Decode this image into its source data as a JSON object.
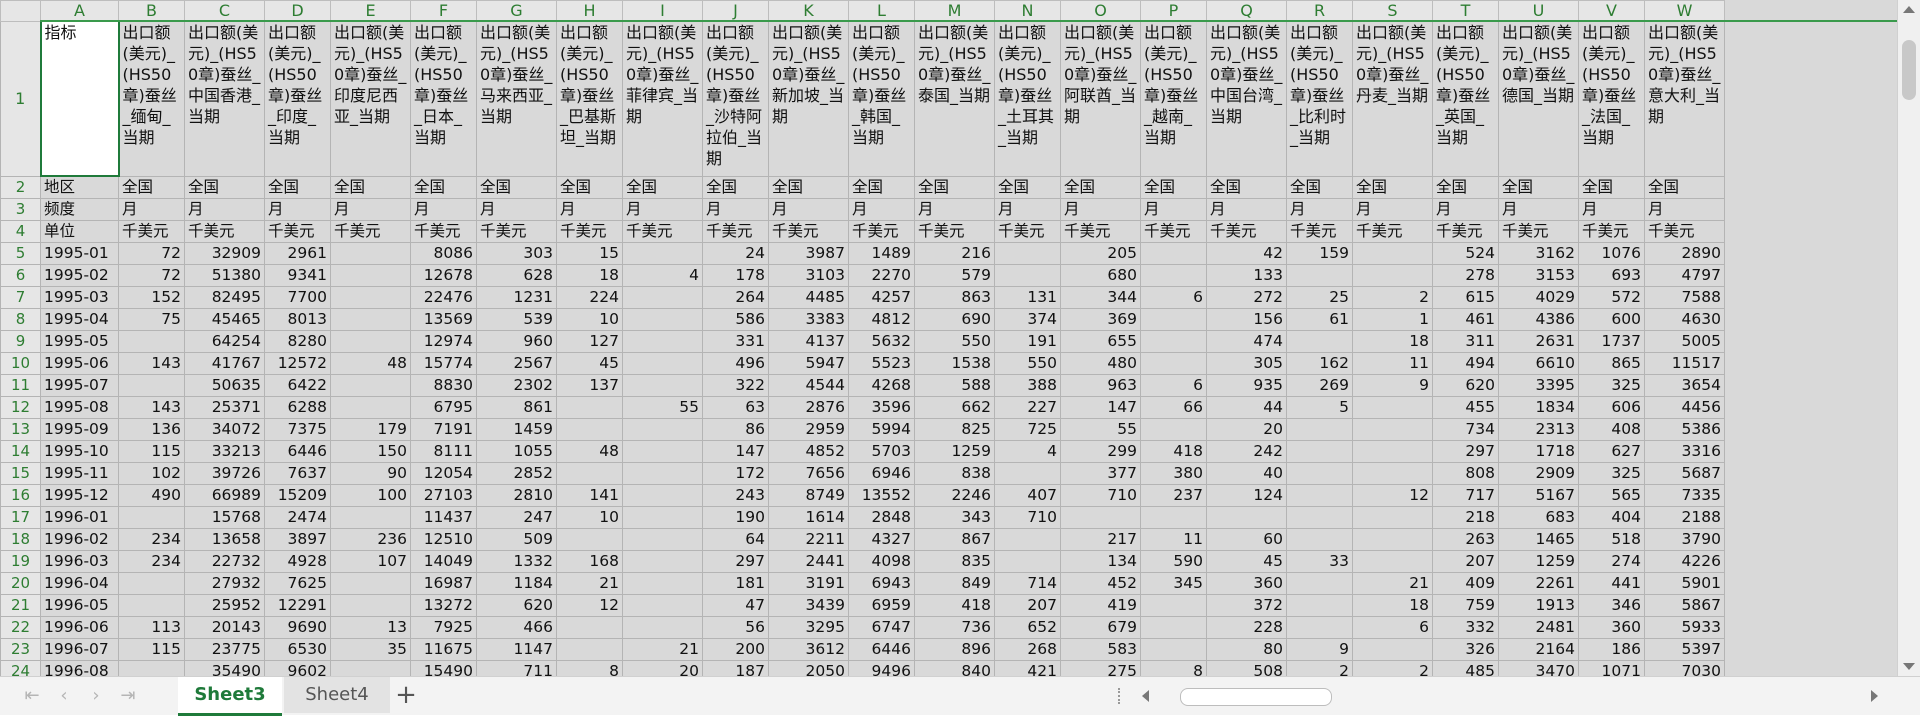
{
  "sheet": {
    "columns": [
      "A",
      "B",
      "C",
      "D",
      "E",
      "F",
      "G",
      "H",
      "I",
      "J",
      "K",
      "L",
      "M",
      "N",
      "O",
      "P",
      "Q",
      "R",
      "S",
      "T",
      "U",
      "V",
      "W"
    ],
    "header_row": [
      "指标",
      "出口额(美元)_(HS50章)蚕丝_缅甸_当期",
      "出口额(美元)_(HS50章)蚕丝_中国香港_当期",
      "出口额(美元)_(HS50章)蚕丝_印度_当期",
      "出口额(美元)_(HS50章)蚕丝_印度尼西亚_当期",
      "出口额(美元)_(HS50章)蚕丝_日本_当期",
      "出口额(美元)_(HS50章)蚕丝_马来西亚_当期",
      "出口额(美元)_(HS50章)蚕丝_巴基斯坦_当期",
      "出口额(美元)_(HS50章)蚕丝_菲律宾_当期",
      "出口额(美元)_(HS50章)蚕丝_沙特阿拉伯_当期",
      "出口额(美元)_(HS50章)蚕丝_新加坡_当期",
      "出口额(美元)_(HS50章)蚕丝_韩国_当期",
      "出口额(美元)_(HS50章)蚕丝_泰国_当期",
      "出口额(美元)_(HS50章)蚕丝_土耳其_当期",
      "出口额(美元)_(HS50章)蚕丝_阿联酋_当期",
      "出口额(美元)_(HS50章)蚕丝_越南_当期",
      "出口额(美元)_(HS50章)蚕丝_中国台湾_当期",
      "出口额(美元)_(HS50章)蚕丝_比利时_当期",
      "出口额(美元)_(HS50章)蚕丝_丹麦_当期",
      "出口额(美元)_(HS50章)蚕丝_英国_当期",
      "出口额(美元)_(HS50章)蚕丝_德国_当期",
      "出口额(美元)_(HS50章)蚕丝_法国_当期",
      "出口额(美元)_(HS50章)蚕丝_意大利_当期"
    ],
    "meta_rows": [
      [
        "地区",
        "全国",
        "全国",
        "全国",
        "全国",
        "全国",
        "全国",
        "全国",
        "全国",
        "全国",
        "全国",
        "全国",
        "全国",
        "全国",
        "全国",
        "全国",
        "全国",
        "全国",
        "全国",
        "全国",
        "全国",
        "全国",
        "全国"
      ],
      [
        "频度",
        "月",
        "月",
        "月",
        "月",
        "月",
        "月",
        "月",
        "月",
        "月",
        "月",
        "月",
        "月",
        "月",
        "月",
        "月",
        "月",
        "月",
        "月",
        "月",
        "月",
        "月",
        "月"
      ],
      [
        "单位",
        "千美元",
        "千美元",
        "千美元",
        "千美元",
        "千美元",
        "千美元",
        "千美元",
        "千美元",
        "千美元",
        "千美元",
        "千美元",
        "千美元",
        "千美元",
        "千美元",
        "千美元",
        "千美元",
        "千美元",
        "千美元",
        "千美元",
        "千美元",
        "千美元",
        "千美元"
      ]
    ],
    "data_rows": [
      [
        "1995-01",
        "72",
        "32909",
        "2961",
        "",
        "8086",
        "303",
        "15",
        "",
        "24",
        "3987",
        "1489",
        "216",
        "",
        "205",
        "",
        "42",
        "159",
        "",
        "524",
        "3162",
        "1076",
        "2890"
      ],
      [
        "1995-02",
        "72",
        "51380",
        "9341",
        "",
        "12678",
        "628",
        "18",
        "4",
        "178",
        "3103",
        "2270",
        "579",
        "",
        "680",
        "",
        "133",
        "",
        "",
        "278",
        "3153",
        "693",
        "4797"
      ],
      [
        "1995-03",
        "152",
        "82495",
        "7700",
        "",
        "22476",
        "1231",
        "224",
        "",
        "264",
        "4485",
        "4257",
        "863",
        "131",
        "344",
        "6",
        "272",
        "25",
        "2",
        "615",
        "4029",
        "572",
        "7588"
      ],
      [
        "1995-04",
        "75",
        "45465",
        "8013",
        "",
        "13569",
        "539",
        "10",
        "",
        "586",
        "3383",
        "4812",
        "690",
        "374",
        "369",
        "",
        "156",
        "61",
        "1",
        "461",
        "4386",
        "600",
        "4630"
      ],
      [
        "1995-05",
        "",
        "64254",
        "8280",
        "",
        "12974",
        "960",
        "127",
        "",
        "331",
        "4137",
        "5632",
        "550",
        "191",
        "655",
        "",
        "474",
        "",
        "18",
        "311",
        "2631",
        "1737",
        "5005"
      ],
      [
        "1995-06",
        "143",
        "41767",
        "12572",
        "48",
        "15774",
        "2567",
        "45",
        "",
        "496",
        "5947",
        "5523",
        "1538",
        "550",
        "480",
        "",
        "305",
        "162",
        "11",
        "494",
        "6610",
        "865",
        "11517"
      ],
      [
        "1995-07",
        "",
        "50635",
        "6422",
        "",
        "8830",
        "2302",
        "137",
        "",
        "322",
        "4544",
        "4268",
        "588",
        "388",
        "963",
        "6",
        "935",
        "269",
        "9",
        "620",
        "3395",
        "325",
        "3654"
      ],
      [
        "1995-08",
        "143",
        "25371",
        "6288",
        "",
        "6795",
        "861",
        "",
        "55",
        "63",
        "2876",
        "3596",
        "662",
        "227",
        "147",
        "66",
        "44",
        "5",
        "",
        "455",
        "1834",
        "606",
        "4456"
      ],
      [
        "1995-09",
        "136",
        "34072",
        "7375",
        "179",
        "7191",
        "1459",
        "",
        "",
        "86",
        "2959",
        "5994",
        "825",
        "725",
        "55",
        "",
        "20",
        "",
        "",
        "734",
        "2313",
        "408",
        "5386"
      ],
      [
        "1995-10",
        "115",
        "33213",
        "6446",
        "150",
        "8111",
        "1055",
        "48",
        "",
        "147",
        "4852",
        "5703",
        "1259",
        "4",
        "299",
        "418",
        "242",
        "",
        "",
        "297",
        "1718",
        "627",
        "3316"
      ],
      [
        "1995-11",
        "102",
        "39726",
        "7637",
        "90",
        "12054",
        "2852",
        "",
        "",
        "172",
        "7656",
        "6946",
        "838",
        "",
        "377",
        "380",
        "40",
        "",
        "",
        "808",
        "2909",
        "325",
        "5687"
      ],
      [
        "1995-12",
        "490",
        "66989",
        "15209",
        "100",
        "27103",
        "2810",
        "141",
        "",
        "243",
        "8749",
        "13552",
        "2246",
        "407",
        "710",
        "237",
        "124",
        "",
        "12",
        "717",
        "5167",
        "565",
        "7335"
      ],
      [
        "1996-01",
        "",
        "15768",
        "2474",
        "",
        "11437",
        "247",
        "10",
        "",
        "190",
        "1614",
        "2848",
        "343",
        "710",
        "",
        "",
        "",
        "",
        "",
        "218",
        "683",
        "404",
        "2188"
      ],
      [
        "1996-02",
        "234",
        "13658",
        "3897",
        "236",
        "12510",
        "509",
        "",
        "",
        "64",
        "2211",
        "4327",
        "867",
        "",
        "217",
        "11",
        "60",
        "",
        "",
        "263",
        "1465",
        "518",
        "3790"
      ],
      [
        "1996-03",
        "234",
        "22732",
        "4928",
        "107",
        "14049",
        "1332",
        "168",
        "",
        "297",
        "2441",
        "4098",
        "835",
        "",
        "134",
        "590",
        "45",
        "33",
        "",
        "207",
        "1259",
        "274",
        "4226"
      ],
      [
        "1996-04",
        "",
        "27932",
        "7625",
        "",
        "16987",
        "1184",
        "21",
        "",
        "181",
        "3191",
        "6943",
        "849",
        "714",
        "452",
        "345",
        "360",
        "",
        "21",
        "409",
        "2261",
        "441",
        "5901"
      ],
      [
        "1996-05",
        "",
        "25952",
        "12291",
        "",
        "13272",
        "620",
        "12",
        "",
        "47",
        "3439",
        "6959",
        "418",
        "207",
        "419",
        "",
        "372",
        "",
        "18",
        "759",
        "1913",
        "346",
        "5867"
      ],
      [
        "1996-06",
        "113",
        "20143",
        "9690",
        "13",
        "7925",
        "466",
        "",
        "",
        "56",
        "3295",
        "6747",
        "736",
        "652",
        "679",
        "",
        "228",
        "",
        "6",
        "332",
        "2481",
        "360",
        "5933"
      ],
      [
        "1996-07",
        "115",
        "23775",
        "6530",
        "35",
        "11675",
        "1147",
        "",
        "21",
        "200",
        "3612",
        "6446",
        "896",
        "268",
        "583",
        "",
        "80",
        "9",
        "",
        "326",
        "2164",
        "186",
        "5397"
      ],
      [
        "1996-08",
        "",
        "35490",
        "9602",
        "",
        "15490",
        "711",
        "8",
        "20",
        "187",
        "2050",
        "9496",
        "840",
        "421",
        "275",
        "8",
        "508",
        "2",
        "2",
        "485",
        "3470",
        "1071",
        "7030"
      ]
    ]
  },
  "tabs": [
    "Sheet3",
    "Sheet4"
  ],
  "icons": {
    "first": "first-sheet-icon",
    "prev": "prev-sheet-icon",
    "next": "next-sheet-icon",
    "last": "last-sheet-icon",
    "add": "add-sheet-icon"
  },
  "colors": {
    "accent": "#1f7a3a",
    "header_text": "#2e7d32",
    "grid_bg": "#d9d9d9"
  }
}
